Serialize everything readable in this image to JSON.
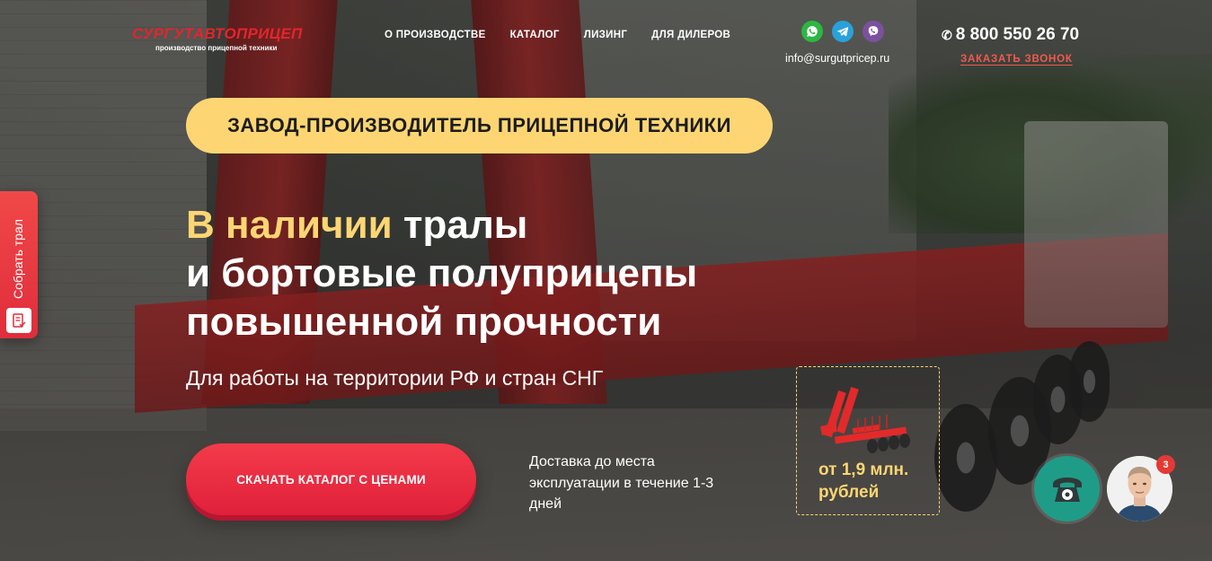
{
  "header": {
    "logo_name": "СУРГУТАВТОПРИЦЕП",
    "logo_tagline": "производство прицепной техники",
    "nav": [
      {
        "label": "О ПРОИЗВОДСТВЕ"
      },
      {
        "label": "КАТАЛОГ"
      },
      {
        "label": "ЛИЗИНГ"
      },
      {
        "label": "ДЛЯ ДИЛЕРОВ"
      }
    ],
    "messengers": [
      "whatsapp-icon",
      "telegram-icon",
      "viber-icon"
    ],
    "email": "info@surgutpricep.ru",
    "phone": "8 800 550 26 70",
    "callback_label": "ЗАКАЗАТЬ ЗВОНОК"
  },
  "hero": {
    "badge": "ЗАВОД-ПРОИЗВОДИТЕЛЬ ПРИЦЕПНОЙ ТЕХНИКИ",
    "headline_accent": "В наличии",
    "headline_line1_rest": " тралы",
    "headline_line2": "и бортовые полуприцепы",
    "headline_line3": "повышенной прочности",
    "subline": "Для работы на территории РФ и стран СНГ",
    "cta_label": "СКАЧАТЬ КАТАЛОГ С ЦЕНАМИ",
    "delivery_text": "Доставка до места эксплуатации в течение 1-3 дней",
    "price_line1": "от 1,9 млн.",
    "price_line2": "рублей"
  },
  "side_tab": {
    "label": "Собрать трал"
  },
  "widgets": {
    "notification_count": "3"
  },
  "colors": {
    "accent_yellow": "#fdd673",
    "cta_red": "#e0203a",
    "logo_red": "#e3252c",
    "callback_red": "#f05a4e",
    "call_widget_teal": "#1e9c88"
  }
}
